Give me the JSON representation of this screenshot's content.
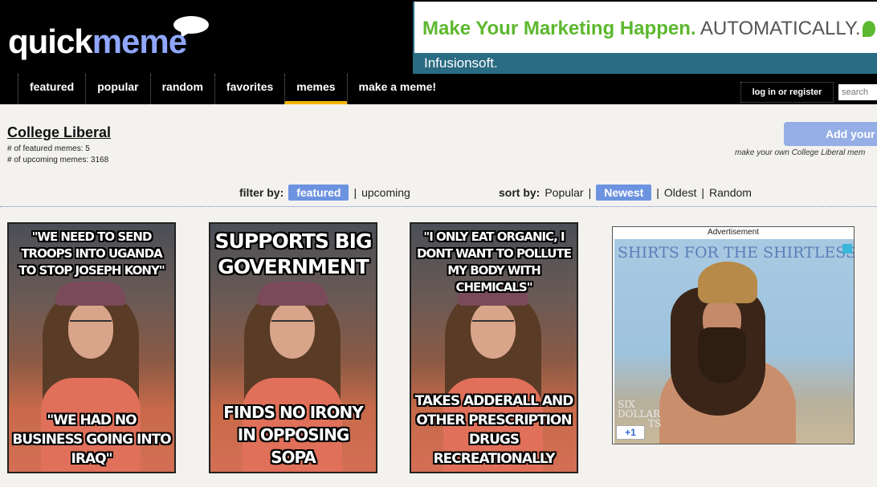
{
  "brand": {
    "logo_part1": "quick",
    "logo_part2": "meme"
  },
  "banner_ad": {
    "headline_green": "Make Your Marketing Happen.",
    "headline_gray": "AUTOMATICALLY.",
    "brand": "Infusionsoft."
  },
  "nav": {
    "items": [
      {
        "label": "featured"
      },
      {
        "label": "popular"
      },
      {
        "label": "random"
      },
      {
        "label": "favorites"
      },
      {
        "label": "memes",
        "active": true
      },
      {
        "label": "make a meme!"
      }
    ],
    "login": "log in or register",
    "search_placeholder": "search"
  },
  "meme_info": {
    "title": "College Liberal",
    "featured_count": "# of featured memes: 5",
    "upcoming_count": "# of upcoming memes: 3168",
    "add_button": "Add your",
    "add_sub": "make your own College Liberal mem"
  },
  "filter": {
    "label": "filter by:",
    "selected": "featured",
    "sep": "|",
    "other": "upcoming"
  },
  "sort": {
    "label": "sort by:",
    "options": [
      "Popular",
      "Newest",
      "Oldest",
      "Random"
    ],
    "selected": "Newest",
    "sep": "|"
  },
  "memes": [
    {
      "top": "\"WE NEED TO SEND TROOPS INTO UGANDA TO STOP JOSEPH KONY\"",
      "bottom": "\"WE HAD NO BUSINESS GOING INTO IRAQ\""
    },
    {
      "top": "SUPPORTS BIG GOVERNMENT",
      "bottom": "FINDS NO IRONY IN OPPOSING SOPA"
    },
    {
      "top": "\"I ONLY EAT ORGANIC, I DONT WANT TO POLLUTE MY BODY WITH CHEMICALS\"",
      "bottom": "TAKES ADDERALL AND OTHER PRESCRIPTION DRUGS RECREATIONALLY"
    }
  ],
  "side_ad": {
    "label": "Advertisement",
    "headline": "SHIRTS FOR THE SHIRTLESS",
    "small_text_1": "SIX",
    "small_text_2": "DOLLAR",
    "small_text_3": "TS",
    "plus_one": "+1"
  }
}
